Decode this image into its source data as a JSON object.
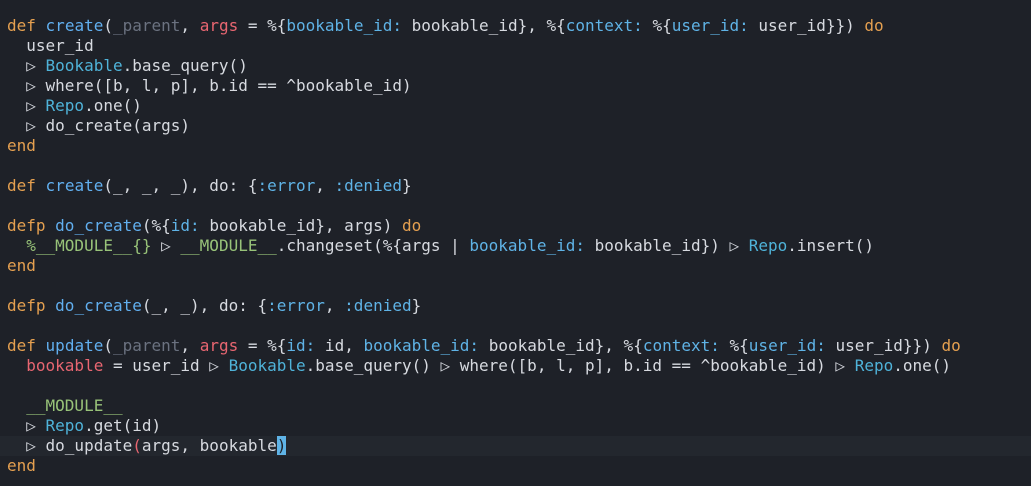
{
  "editor": {
    "lines": [
      "def create(_parent, args = %{bookable_id: bookable_id}, %{context: %{user_id: user_id}}) do",
      "  user_id",
      "  ▷ Bookable.base_query()",
      "  ▷ where([b, l, p], b.id == ^bookable_id)",
      "  ▷ Repo.one()",
      "  ▷ do_create(args)",
      "end",
      "",
      "def create(_, _, _), do: {:error, :denied}",
      "",
      "defp do_create(%{id: bookable_id}, args) do",
      "  %__MODULE__{} ▷ __MODULE__.changeset(%{args | bookable_id: bookable_id}) ▷ Repo.insert()",
      "end",
      "",
      "defp do_create(_, _), do: {:error, :denied}",
      "",
      "def update(_parent, args = %{id: id, bookable_id: bookable_id}, %{context: %{user_id: user_id}}) do",
      "  bookable = user_id ▷ Bookable.base_query() ▷ where([b, l, p], b.id == ^bookable_id) ▷ Repo.one()",
      "",
      "  __MODULE__",
      "  ▷ Repo.get(id)",
      "  ▷ do_update(args, bookable)",
      "end"
    ],
    "current_line": 22,
    "cursor_char": ")"
  },
  "colors": {
    "background": "#1e2128",
    "current_line_bg": "#23272e",
    "keyword": "#e5a050",
    "function": "#61afef",
    "module": "#4fb3d9",
    "atom_key": "#5fb3e6",
    "unused_var": "#6b7280",
    "variable": "#e86671",
    "macro": "#98c379",
    "text": "#d7dae0",
    "cursor": "#5fb3e6"
  }
}
